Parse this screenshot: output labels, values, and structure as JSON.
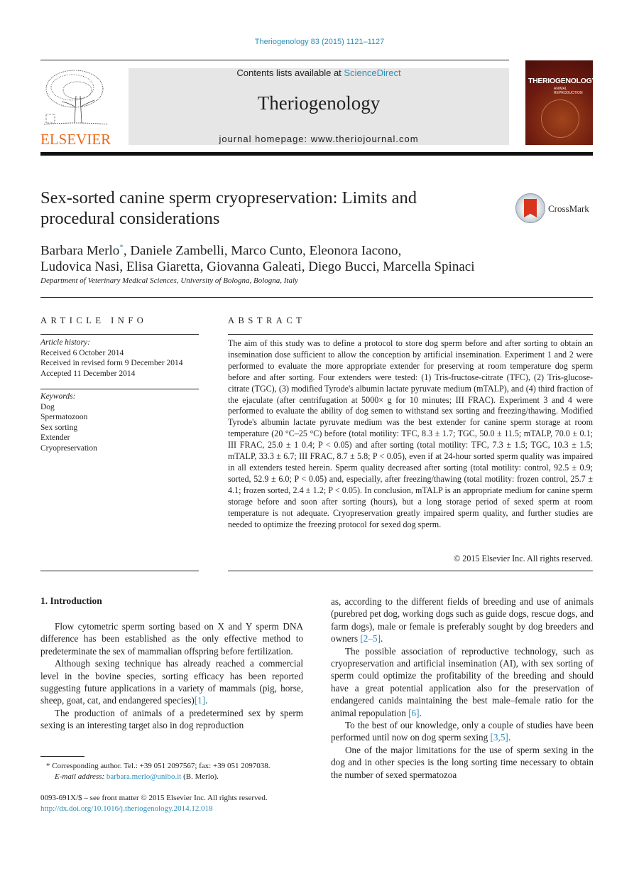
{
  "citation": "Theriogenology 83 (2015) 1121–1127",
  "header": {
    "contents_prefix": "Contents lists available at ",
    "contents_link": "ScienceDirect",
    "journal_name": "Theriogenology",
    "homepage": "journal homepage: www.theriojournal.com",
    "publisher_logo_text": "ELSEVIER",
    "cover_title": "THERIOGENOLOGY",
    "cover_subtitle": "ANIMAL REPRODUCTION",
    "crossmark_label": "CrossMark"
  },
  "article": {
    "title": "Sex-sorted canine sperm cryopreservation: Limits and procedural considerations",
    "authors_line1_first": "Barbara Merlo",
    "corresponding_mark": "*",
    "authors_line1_rest": ", Daniele Zambelli, Marco Cunto, Eleonora Iacono,",
    "authors_line2": "Ludovica Nasi, Elisa Giaretta, Giovanna Galeati, Diego Bucci, Marcella Spinaci",
    "affiliation": "Department of Veterinary Medical Sciences, University of Bologna, Bologna, Italy"
  },
  "article_info": {
    "heading": "ARTICLE INFO",
    "history_label": "Article history:",
    "history": [
      "Received 6 October 2014",
      "Received in revised form 9 December 2014",
      "Accepted 11 December 2014"
    ],
    "keywords_label": "Keywords:",
    "keywords": [
      "Dog",
      "Spermatozoon",
      "Sex sorting",
      "Extender",
      "Cryopreservation"
    ]
  },
  "abstract": {
    "heading": "ABSTRACT",
    "text": "The aim of this study was to define a protocol to store dog sperm before and after sorting to obtain an insemination dose sufficient to allow the conception by artificial insemination. Experiment 1 and 2 were performed to evaluate the more appropriate extender for preserving at room temperature dog sperm before and after sorting. Four extenders were tested: (1) Tris-fructose-citrate (TFC), (2) Tris-glucose-citrate (TGC), (3) modified Tyrode's albumin lactate pyruvate medium (mTALP), and (4) third fraction of the ejaculate (after centrifugation at 5000× g for 10 minutes; III FRAC). Experiment 3 and 4 were performed to evaluate the ability of dog semen to withstand sex sorting and freezing/thawing. Modified Tyrode's albumin lactate pyruvate medium was the best extender for canine sperm storage at room temperature (20 °C–25 °C) before (total motility: TFC, 8.3 ± 1.7; TGC, 50.0 ± 11.5; mTALP, 70.0 ± 0.1; III FRAC, 25.0 ± 1 0.4; P < 0.05) and after sorting (total motility: TFC, 7.3 ± 1.5; TGC, 10.3 ± 1.5; mTALP, 33.3 ± 6.7; III FRAC, 8.7 ± 5.8; P < 0.05), even if at 24-hour sorted sperm quality was impaired in all extenders tested herein. Sperm quality decreased after sorting (total motility: control, 92.5 ± 0.9; sorted, 52.9 ± 6.0; P < 0.05) and, especially, after freezing/thawing (total motility: frozen control, 25.7 ± 4.1; frozen sorted, 2.4 ± 1.2; P < 0.05). In conclusion, mTALP is an appropriate medium for canine sperm storage before and soon after sorting (hours), but a long storage period of sexed sperm at room temperature is not adequate. Cryopreservation greatly impaired sperm quality, and further studies are needed to optimize the freezing protocol for sexed dog sperm.",
    "copyright": "© 2015 Elsevier Inc. All rights reserved."
  },
  "intro": {
    "heading": "1.  Introduction",
    "p1": "Flow cytometric sperm sorting based on X and Y sperm DNA difference has been established as the only effective method to predeterminate the sex of mammalian offspring before fertilization.",
    "p2_text": "Although sexing technique has already reached a commercial level in the bovine species, sorting efficacy has been reported suggesting future applications in a variety of mammals (pig, horse, sheep, goat, cat, and endangered species)",
    "p2_ref": "[1]",
    "p3": "The production of animals of a predetermined sex by sperm sexing is an interesting target also in dog reproduction",
    "r1_text": "as, according to the different fields of breeding and use of animals (purebred pet dog, working dogs such as guide dogs, rescue dogs, and farm dogs), male or female is preferably sought by dog breeders and owners ",
    "r1_ref": "[2–5]",
    "r2_text": "The possible association of reproductive technology, such as cryopreservation and artificial insemination (AI), with sex sorting of sperm could optimize the profitability of the breeding and should have a great potential application also for the preservation of endangered canids maintaining the best male–female ratio for the animal repopulation ",
    "r2_ref": "[6]",
    "r3_text": "To the best of our knowledge, only a couple of studies have been performed until now on dog sperm sexing ",
    "r3_ref": "[3,5]",
    "r4": "One of the major limitations for the use of sperm sexing in the dog and in other species is the long sorting time necessary to obtain the number of sexed spermatozoa"
  },
  "footnote": {
    "mark": "*",
    "corresponding": "Corresponding author. Tel.: +39 051 2097567; fax: +39 051 2097038.",
    "email_label": "E-mail address:",
    "email": "barbara.merlo@unibo.it",
    "email_suffix": " (B. Merlo).",
    "front_matter": "0093-691X/$ – see front matter © 2015 Elsevier Inc. All rights reserved.",
    "doi": "http://dx.doi.org/10.1016/j.theriogenology.2014.12.018"
  }
}
